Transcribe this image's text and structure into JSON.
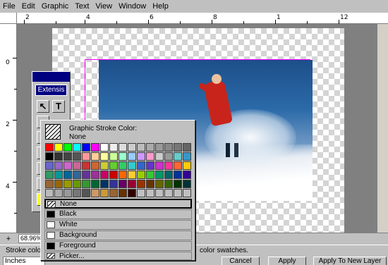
{
  "menubar": {
    "items": [
      "File",
      "Edit",
      "Graphic",
      "Text",
      "View",
      "Window",
      "Help"
    ]
  },
  "rulers": {
    "horizontal_labels": [
      "2",
      "4",
      "6",
      "8",
      "1",
      "12"
    ],
    "vertical_labels": [
      "0",
      "2",
      "4"
    ]
  },
  "toolbox": {
    "header": "Extensis",
    "tools": [
      {
        "icon": "arrow-pointer-icon",
        "glyph": "↖"
      },
      {
        "icon": "text-tool-icon",
        "glyph": "T"
      }
    ]
  },
  "zoom": {
    "value": "68.96%"
  },
  "status": {
    "left": "Stroke colo",
    "right": "color swatches."
  },
  "bottom": {
    "units": "Inches",
    "cancel_label": "Cancel",
    "apply_label": "Apply",
    "apply_new_layer_label": "Apply To New Layer"
  },
  "popup": {
    "title": "Graphic Stroke Color:",
    "current_value": "None",
    "swatch_rows": [
      [
        "#ff0000",
        "#ffff00",
        "#00ff00",
        "#00ffff",
        "#0000ff",
        "#ff00ff",
        "#ffffff",
        "#eeeeee",
        "#dddddd",
        "#cccccc",
        "#bbbbbb",
        "#aaaaaa",
        "#999999",
        "#888888",
        "#777777",
        "#666666"
      ],
      [
        "#000000",
        "#333333",
        "#444444",
        "#555555",
        "#ff9999",
        "#ffcc99",
        "#ffff99",
        "#ccff99",
        "#99ffcc",
        "#99ccff",
        "#cc99ff",
        "#ff99cc",
        "#cccccc",
        "#999999",
        "#66cccc",
        "#3399cc"
      ],
      [
        "#6666cc",
        "#9966cc",
        "#cc66cc",
        "#cc6699",
        "#cc3333",
        "#cc6633",
        "#cccc33",
        "#66cc33",
        "#33cc66",
        "#33cccc",
        "#3366cc",
        "#6633cc",
        "#cc33cc",
        "#ff3399",
        "#ff6633",
        "#ffcc00"
      ],
      [
        "#339966",
        "#009999",
        "#006699",
        "#336699",
        "#663399",
        "#993399",
        "#cc0066",
        "#cc0000",
        "#ff6600",
        "#ffcc33",
        "#99cc00",
        "#33cc33",
        "#009966",
        "#006666",
        "#003399",
        "#330099"
      ],
      [
        "#996633",
        "#996600",
        "#999900",
        "#669900",
        "#339933",
        "#006633",
        "#003366",
        "#333399",
        "#660066",
        "#990033",
        "#993300",
        "#663300",
        "#666600",
        "#336600",
        "#003300",
        "#003333"
      ],
      [
        "#bbbbbb",
        "#aaaaaa",
        "#999999",
        "#777777",
        "#555555",
        "#cc9966",
        "#cc9933",
        "#996633",
        "#663300",
        "#330000",
        "#c0c0c0",
        "#c0c0c0",
        "#c0c0c0",
        "#c0c0c0",
        "#c0c0c0",
        "#c0c0c0"
      ]
    ],
    "options": [
      {
        "label": "None",
        "swatch": "hatch",
        "selected": true
      },
      {
        "label": "Black",
        "swatch": "#000000",
        "selected": false
      },
      {
        "label": "White",
        "swatch": "#ffffff",
        "selected": false
      },
      {
        "label": "Background",
        "swatch": "#ffffff",
        "selected": false
      },
      {
        "label": "Foreground",
        "swatch": "#000000",
        "selected": false
      },
      {
        "label": "Picker...",
        "swatch": "hatch",
        "selected": false
      }
    ]
  },
  "colors": {
    "selection_frame": "#ff00ff",
    "title_bar": "#000080"
  }
}
